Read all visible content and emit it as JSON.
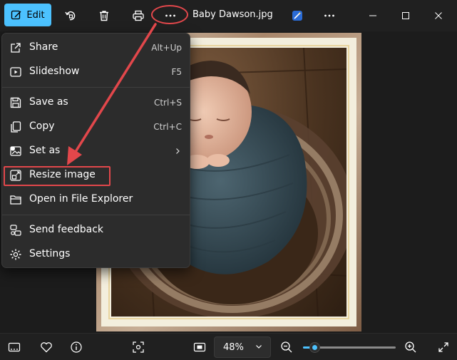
{
  "toolbar": {
    "edit_label": "Edit",
    "file_title": "Baby Dawson.jpg"
  },
  "menu": {
    "items": [
      {
        "label": "Share",
        "shortcut": "Alt+Up",
        "icon": "share-icon"
      },
      {
        "label": "Slideshow",
        "shortcut": "F5",
        "icon": "slideshow-icon"
      },
      {
        "label": "Save as",
        "shortcut": "Ctrl+S",
        "icon": "save-icon"
      },
      {
        "label": "Copy",
        "shortcut": "Ctrl+C",
        "icon": "copy-icon"
      },
      {
        "label": "Set as",
        "shortcut": "",
        "icon": "set-as-icon"
      },
      {
        "label": "Resize image",
        "shortcut": "",
        "icon": "resize-icon"
      },
      {
        "label": "Open in File Explorer",
        "shortcut": "",
        "icon": "folder-icon"
      },
      {
        "label": "Send feedback",
        "shortcut": "",
        "icon": "feedback-icon"
      },
      {
        "label": "Settings",
        "shortcut": "",
        "icon": "gear-icon"
      }
    ]
  },
  "bottombar": {
    "zoom_value": "48%",
    "zoom_slider_fraction": 0.12
  },
  "colors": {
    "accent": "#4cc2ff",
    "annotation": "#e2474b",
    "menu_bg": "#2c2c2c",
    "toolbar_bg": "#202020"
  }
}
